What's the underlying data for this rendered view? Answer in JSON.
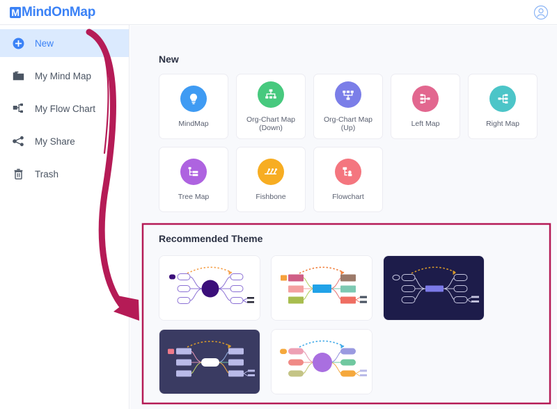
{
  "header": {
    "logo_text": "MindOnMap",
    "logo_mark": "M",
    "avatar_icon": "user-account-icon"
  },
  "sidebar": {
    "items": [
      {
        "label": "New",
        "icon": "plus-circle-icon",
        "active": true
      },
      {
        "label": "My Mind Map",
        "icon": "folder-icon",
        "active": false
      },
      {
        "label": "My Flow Chart",
        "icon": "flow-chart-icon",
        "active": false
      },
      {
        "label": "My Share",
        "icon": "share-icon",
        "active": false
      },
      {
        "label": "Trash",
        "icon": "trash-icon",
        "active": false
      }
    ]
  },
  "main": {
    "new_section": {
      "title": "New",
      "cards": [
        {
          "label": "MindMap",
          "icon": "lightbulb-icon",
          "color": "#3f9bf3"
        },
        {
          "label": "Org-Chart Map (Down)",
          "icon": "org-chart-down-icon",
          "color": "#47c97e"
        },
        {
          "label": "Org-Chart Map (Up)",
          "icon": "org-chart-up-icon",
          "color": "#7b7ee8"
        },
        {
          "label": "Left Map",
          "icon": "left-map-icon",
          "color": "#e2678f"
        },
        {
          "label": "Right Map",
          "icon": "right-map-icon",
          "color": "#4cc5c8"
        },
        {
          "label": "Tree Map",
          "icon": "tree-map-icon",
          "color": "#ae63e0"
        },
        {
          "label": "Fishbone",
          "icon": "fishbone-icon",
          "color": "#f7ad22"
        },
        {
          "label": "Flowchart",
          "icon": "flowchart-icon",
          "color": "#f4767f"
        }
      ]
    },
    "theme_section": {
      "title": "Recommended Theme",
      "themes": [
        {
          "name": "purple-light-theme",
          "background": "#ffffff",
          "center": "#3b0f7a",
          "node_fill": "#ffffff",
          "node_stroke": "#8a6fd4",
          "arrow": "#f5a04a",
          "center_shape": "circle"
        },
        {
          "name": "colorful-box-theme",
          "background": "#ffffff",
          "center": "#21a2e8",
          "node_fill": "#ffffff",
          "node_stroke": "#dddddd",
          "arrow": "#f07f3c",
          "center_shape": "rect"
        },
        {
          "name": "dark-navy-theme",
          "background": "#1d1c4a",
          "center": "#7c7ae8",
          "node_fill": "#1d1c4a",
          "node_stroke": "#c6c6e0",
          "arrow": "#d79a2b",
          "center_shape": "rect"
        },
        {
          "name": "dark-slate-theme",
          "background": "#3a3b62",
          "center": "#ffffff",
          "node_fill": "#b9bae8",
          "node_stroke": "#b9bae8",
          "arrow": "#d79a2b",
          "center_shape": "pill"
        },
        {
          "name": "pastel-circle-theme",
          "background": "#ffffff",
          "center": "#a96fe0",
          "node_fill": "#ffffff",
          "node_stroke": "#dddddd",
          "arrow": "#3fa9e8",
          "center_shape": "circle"
        }
      ]
    }
  },
  "annotations": {
    "arrow_color": "#b51b56",
    "highlight_box_color": "#b51b56",
    "arrow_name": "pointer-arrow-to-recommended-theme",
    "box_name": "highlight-box-recommended-theme"
  }
}
